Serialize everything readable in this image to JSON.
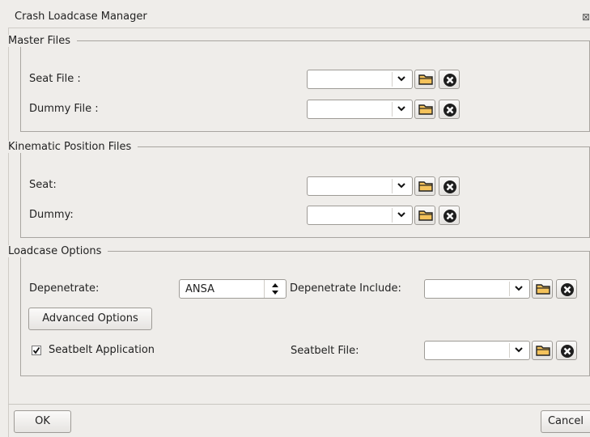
{
  "window": {
    "title": "Crash Loadcase Manager"
  },
  "master_files": {
    "legend": "Master Files",
    "seat_label": "Seat File :",
    "dummy_label": "Dummy File :"
  },
  "kinematic_files": {
    "legend": "Kinematic Position Files",
    "seat_label": "Seat:",
    "dummy_label": "Dummy:"
  },
  "loadcase_options": {
    "legend": "Loadcase Options",
    "depenetrate_label": "Depenetrate:",
    "depenetrate_value": "ANSA",
    "depenetrate_include_label": "Depenetrate Include:",
    "advanced_options_label": "Advanced Options",
    "seatbelt_application_label": "Seatbelt Application",
    "seatbelt_application_checked": true,
    "seatbelt_file_label": "Seatbelt File:"
  },
  "footer": {
    "ok_label": "OK",
    "cancel_label": "Cancel"
  },
  "icons": {
    "close": "close-icon",
    "dropdown": "chevron-down-icon",
    "folder": "folder-icon",
    "clear": "clear-circle-x-icon",
    "spin": "up-down-arrows-icon",
    "check": "checkmark-icon"
  },
  "colors": {
    "background": "#efedea",
    "folder_fill": "#f4c25b",
    "clear_fill": "#1e1e1e"
  }
}
